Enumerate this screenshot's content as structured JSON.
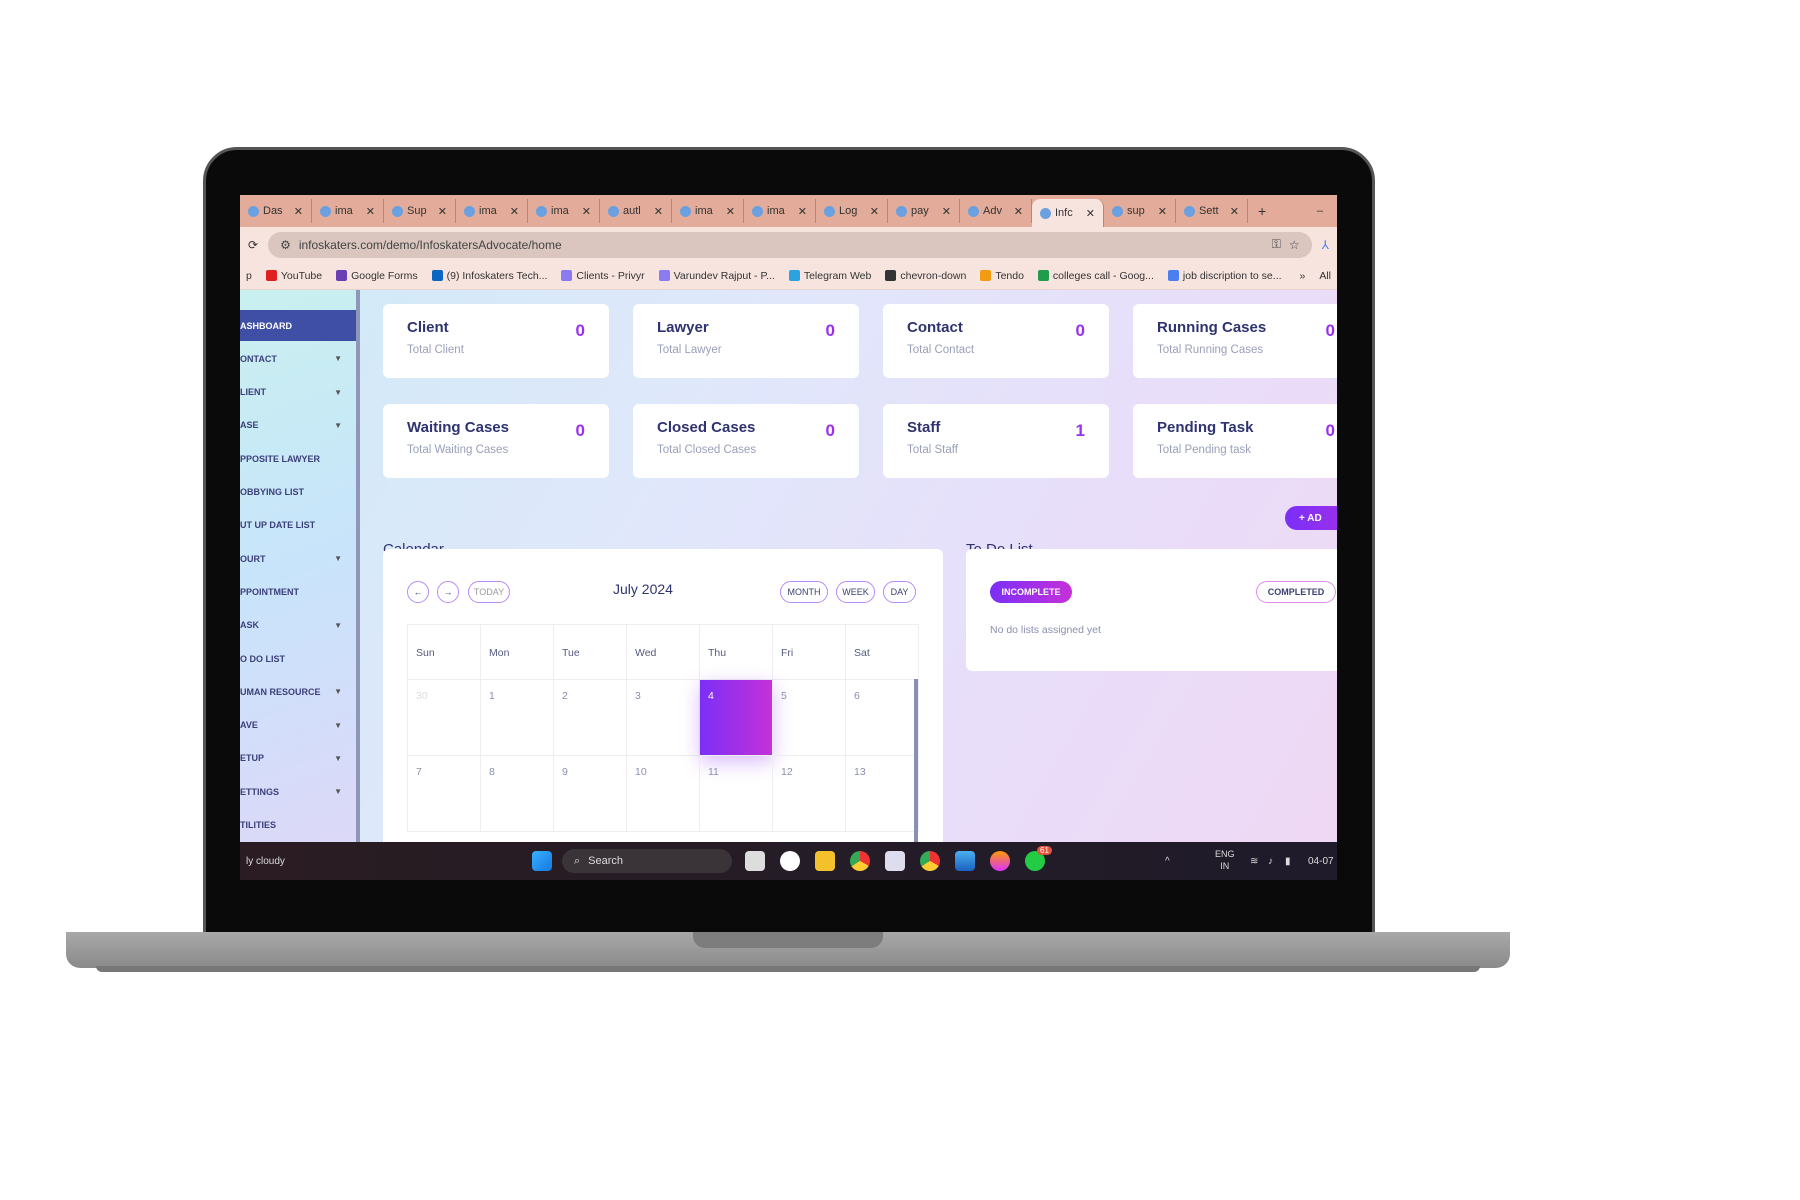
{
  "browser": {
    "tabs": [
      {
        "label": "Das"
      },
      {
        "label": "ima"
      },
      {
        "label": "Sup"
      },
      {
        "label": "ima"
      },
      {
        "label": "ima"
      },
      {
        "label": "autl"
      },
      {
        "label": "ima"
      },
      {
        "label": "ima"
      },
      {
        "label": "Log"
      },
      {
        "label": "pay"
      },
      {
        "label": "Adv"
      },
      {
        "label": "Infc",
        "active": true
      },
      {
        "label": "sup"
      },
      {
        "label": "Sett"
      }
    ],
    "new_tab": "+",
    "minimize": "–",
    "close": "✕",
    "url": "infoskaters.com/demo/InfoskatersAdvocate/home",
    "bookmarks": [
      {
        "label": "p"
      },
      {
        "label": "YouTube",
        "color": "#e02020"
      },
      {
        "label": "Google Forms",
        "color": "#6a3fb5"
      },
      {
        "label": "(9) Infoskaters Tech...",
        "color": "#0a66c2"
      },
      {
        "label": "Clients - Privyr",
        "color": "#8a7cf0"
      },
      {
        "label": "Varundev Rajput - P...",
        "color": "#8a7cf0"
      },
      {
        "label": "Telegram Web",
        "color": "#2aa3e0"
      },
      {
        "label": "chevron-down",
        "color": "#333"
      },
      {
        "label": "Tendo",
        "color": "#f39c12"
      },
      {
        "label": "colleges call - Goog...",
        "color": "#1e9e4a"
      },
      {
        "label": "job discription to se...",
        "color": "#4a7ff0"
      }
    ],
    "more": "»",
    "all_bookmarks": "All"
  },
  "sidebar": {
    "items": [
      {
        "label": "ASHBOARD",
        "active": true
      },
      {
        "label": "ONTACT",
        "caret": true
      },
      {
        "label": "LIENT",
        "caret": true
      },
      {
        "label": "ASE",
        "caret": true
      },
      {
        "label": "PPOSITE LAWYER"
      },
      {
        "label": "OBBYING LIST"
      },
      {
        "label": "UT UP DATE LIST"
      },
      {
        "label": "OURT",
        "caret": true
      },
      {
        "label": "PPOINTMENT"
      },
      {
        "label": "ASK",
        "caret": true
      },
      {
        "label": "O DO LIST"
      },
      {
        "label": "UMAN RESOURCE",
        "caret": true
      },
      {
        "label": "AVE",
        "caret": true
      },
      {
        "label": "ETUP",
        "caret": true
      },
      {
        "label": "ETTINGS",
        "caret": true
      },
      {
        "label": "TILITIES"
      }
    ]
  },
  "cards": [
    {
      "title": "Client",
      "subtitle": "Total Client",
      "value": "0"
    },
    {
      "title": "Lawyer",
      "subtitle": "Total Lawyer",
      "value": "0"
    },
    {
      "title": "Contact",
      "subtitle": "Total Contact",
      "value": "0"
    },
    {
      "title": "Running Cases",
      "subtitle": "Total Running Cases",
      "value": "0"
    },
    {
      "title": "Waiting Cases",
      "subtitle": "Total Waiting Cases",
      "value": "0"
    },
    {
      "title": "Closed Cases",
      "subtitle": "Total Closed Cases",
      "value": "0"
    },
    {
      "title": "Staff",
      "subtitle": "Total Staff",
      "value": "1"
    },
    {
      "title": "Pending Task",
      "subtitle": "Total Pending task",
      "value": "0"
    }
  ],
  "calendar": {
    "title": "Calendar",
    "month": "July 2024",
    "today": "TODAY",
    "prev": "←",
    "next": "→",
    "views": [
      "MONTH",
      "WEEK",
      "DAY"
    ],
    "weekdays": [
      "Sun",
      "Mon",
      "Tue",
      "Wed",
      "Thu",
      "Fri",
      "Sat"
    ],
    "weeks": [
      [
        "30",
        "1",
        "2",
        "3",
        "4",
        "5",
        "6"
      ],
      [
        "7",
        "8",
        "9",
        "10",
        "11",
        "12",
        "13"
      ]
    ],
    "today_date": "4"
  },
  "todo": {
    "title": "To Do List",
    "add": "+ AD",
    "tab_incomplete": "INCOMPLETE",
    "tab_completed": "COMPLETED",
    "empty": "No do lists assigned yet"
  },
  "taskbar": {
    "weather": "ly cloudy",
    "search": "Search",
    "lang1": "ENG",
    "lang2": "IN",
    "time": "04-07",
    "badge": "61"
  },
  "colors": {
    "accent": "#9b2ff0",
    "sidebar_active": "#3f4fa5",
    "title": "#2f3370"
  }
}
